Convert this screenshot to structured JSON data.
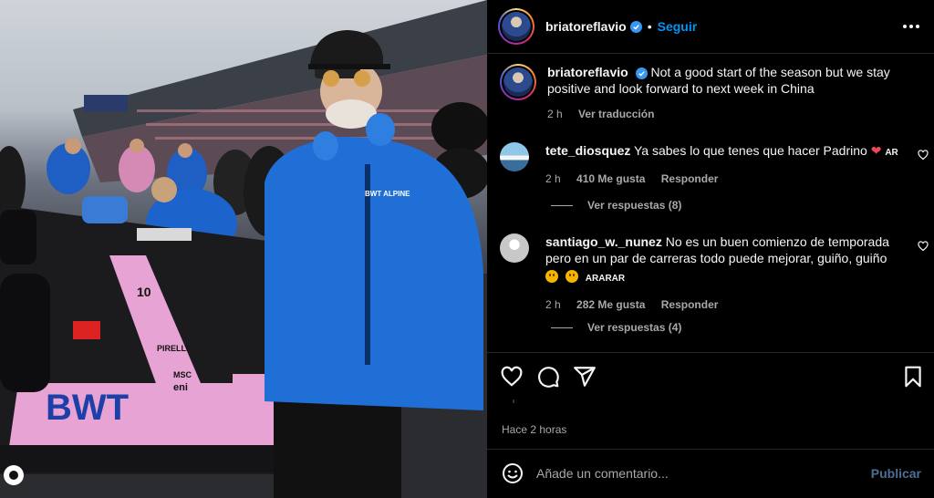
{
  "post": {
    "username": "briatoreflavio",
    "follow_label": "Seguir",
    "separator": "•",
    "caption": "Not a good start of the season but we stay positive and look forward to next week in China",
    "caption_time": "2 h",
    "translate_label": "Ver traducción"
  },
  "photo": {
    "car_text_1": "BWT",
    "car_text_2": "10",
    "car_text_3": "PIRELLI",
    "car_text_4": "MSC",
    "car_text_5": "eni",
    "jacket_text": "BWT ALPINE",
    "crowd_sign": "",
    "colors": {
      "car_pink": "#e6a3d3",
      "jacket_blue": "#1f6fd6",
      "sky": "#cfd4da"
    }
  },
  "comments": [
    {
      "username": "tete_diosquez",
      "text": "Ya sabes lo que tenes que hacer Padrino",
      "suffix": "AR",
      "time": "2 h",
      "likes": "410 Me gusta",
      "reply_label": "Responder",
      "view_replies": "Ver respuestas (8)"
    },
    {
      "username": "santiago_w._nunez",
      "text": "No es un buen comienzo de temporada pero en un par de carreras todo puede mejorar, guiño, guiño",
      "suffix": "ARARAR",
      "time": "2 h",
      "likes": "282 Me gusta",
      "reply_label": "Responder",
      "view_replies": "Ver respuestas (4)"
    }
  ],
  "footer": {
    "time_ago": "Hace 2 horas",
    "comment_placeholder": "Añade un comentario...",
    "publish_label": "Publicar"
  },
  "icons": [
    "heart-icon",
    "comment-icon",
    "share-icon",
    "bookmark-icon",
    "emoji-icon",
    "more-icon",
    "verified-icon"
  ],
  "theme": {
    "accent": "#0095f6",
    "verified": "#3897f0",
    "muted": "#a8a8a8",
    "divider": "#262626"
  }
}
